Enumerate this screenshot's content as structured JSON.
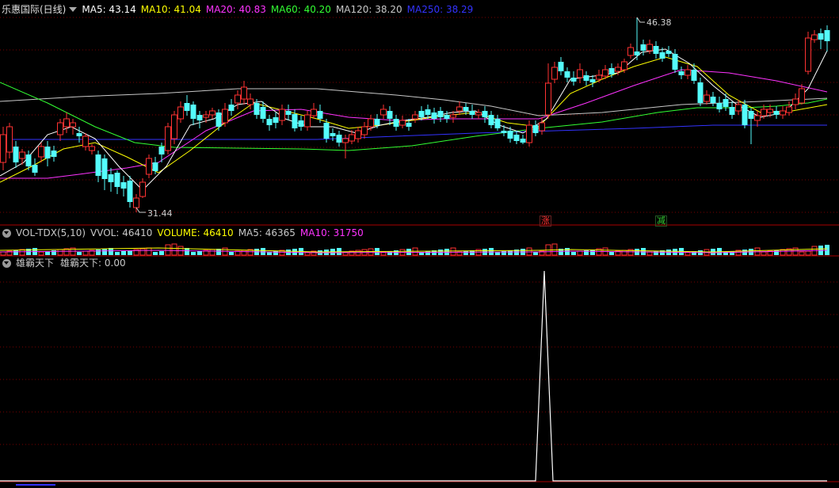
{
  "main": {
    "title": "乐惠国际(日线)",
    "ma": [
      {
        "label": "MA5: 43.14",
        "color": "#ffffff"
      },
      {
        "label": "MA10: 41.04",
        "color": "#ffff00"
      },
      {
        "label": "MA20: 40.83",
        "color": "#ff33ff"
      },
      {
        "label": "MA60: 40.20",
        "color": "#33ff33"
      },
      {
        "label": "MA120: 38.20",
        "color": "#c8c8c8"
      },
      {
        "label": "MA250: 38.29",
        "color": "#3333ff"
      }
    ],
    "high_label": "46.38",
    "low_label": "31.44",
    "badge_up": "涨",
    "badge_down": "减"
  },
  "vol": {
    "name": "VOL-TDX(5,10)",
    "items": [
      {
        "label": "VVOL: 46410",
        "color": "#c8c8c8"
      },
      {
        "label": "VOLUME: 46410",
        "color": "#ffff00"
      },
      {
        "label": "MA5: 46365",
        "color": "#c8c8c8"
      },
      {
        "label": "MA10: 31750",
        "color": "#ff33ff"
      }
    ]
  },
  "ind": {
    "name": "雄霸天下",
    "value": "雄霸天下: 0.00"
  },
  "colors": {
    "up": "#ff3232",
    "down": "#54fcfc",
    "grid": "#7a0000",
    "separator": "#aa0000"
  }
}
